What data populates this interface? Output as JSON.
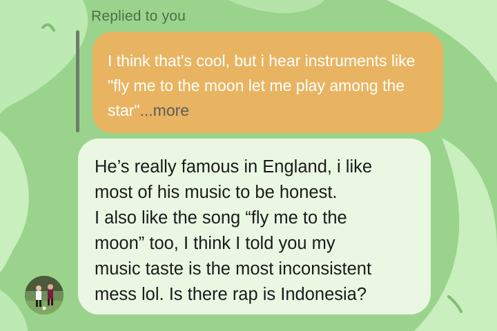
{
  "reply_header": "Replied to you",
  "quoted_message": {
    "text": "I think that's cool, but i hear instruments like \"fly me to the moon let me play among the star\"",
    "more_label": "...more",
    "bubble_color": "#e8b462"
  },
  "message": {
    "lines": [
      "He’s really famous in England, i like",
      "most of his music to be honest.",
      "I also like the song “fly me to the",
      "moon” too, I think I told you my",
      "music taste is the most inconsistent",
      "mess lol. Is there rap is Indonesia?"
    ],
    "bubble_color": "#eaf8e3"
  },
  "sender_avatar": {
    "icon": "avatar-photo-football-players"
  },
  "theme": {
    "background": "#9ad48c",
    "accent_light": "#c8efbd"
  }
}
